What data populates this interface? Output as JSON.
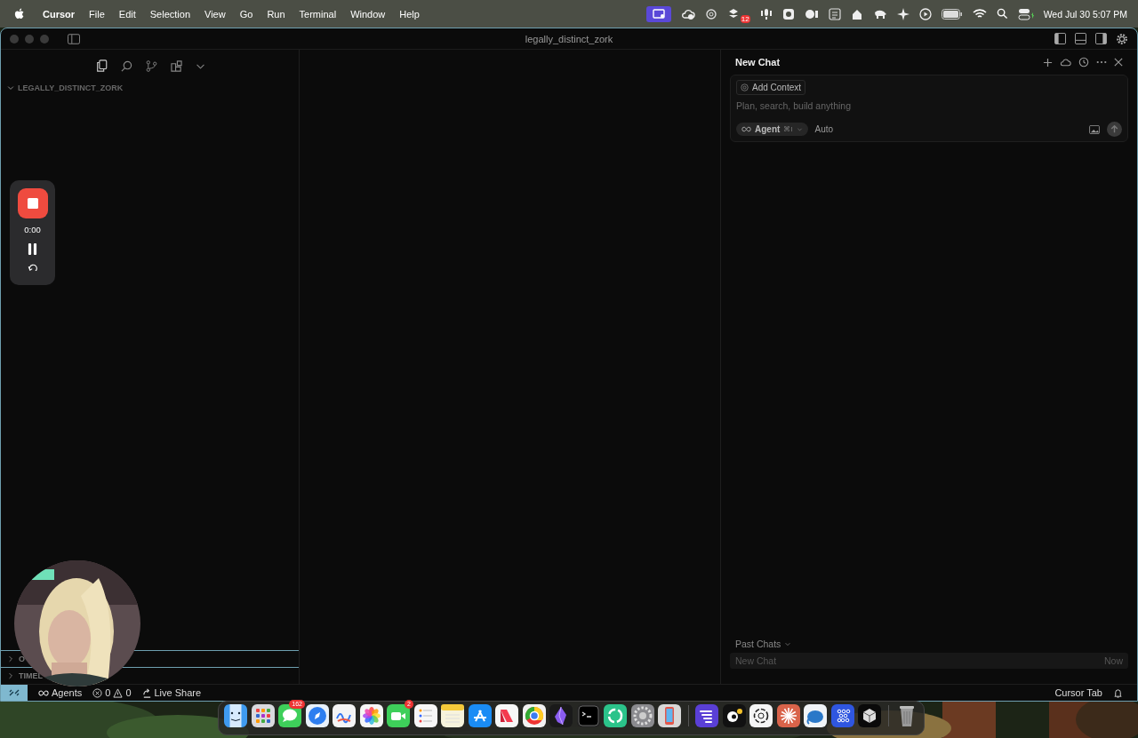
{
  "menubar": {
    "app_name": "Cursor",
    "menus": [
      "File",
      "Edit",
      "Selection",
      "View",
      "Go",
      "Run",
      "Terminal",
      "Window",
      "Help"
    ],
    "status_badge": "12",
    "clock": "Wed Jul 30  5:07 PM"
  },
  "window": {
    "title": "legally_distinct_zork"
  },
  "sidebar": {
    "folder": {
      "label": "LEGALLY_DISTINCT_ZORK",
      "expanded": true
    },
    "sections": [
      {
        "label": "O",
        "expanded": false
      },
      {
        "label": "TIMEL",
        "expanded": false
      }
    ]
  },
  "recorder": {
    "time": "0:00"
  },
  "chat": {
    "title": "New Chat",
    "context_button": "Add Context",
    "placeholder": "Plan, search, build anything",
    "mode": "Agent",
    "mode_shortcut": "⌘I",
    "model": "Auto",
    "past_chats_label": "Past Chats",
    "past_chats": [
      {
        "title": "New Chat",
        "time": "Now"
      }
    ]
  },
  "status_bar": {
    "agents": "Agents",
    "errors": "0",
    "warnings": "0",
    "live_share": "Live Share",
    "cursor_tab": "Cursor Tab"
  },
  "dock": [
    {
      "kind": "face"
    },
    {
      "kind": "grid"
    },
    {
      "kind": "bubble",
      "badge": "162"
    },
    {
      "kind": "compass"
    },
    {
      "kind": "scribble"
    },
    {
      "kind": "flower"
    },
    {
      "kind": "video",
      "badge": "2"
    },
    {
      "kind": "list"
    },
    {
      "kind": "notepad"
    },
    {
      "kind": "cross"
    },
    {
      "kind": "ribbon"
    },
    {
      "kind": "ring"
    },
    {
      "kind": "gem"
    },
    {
      "kind": "terminal"
    },
    {
      "kind": "arrows"
    },
    {
      "kind": "gear"
    },
    {
      "kind": "phone"
    },
    {
      "kind": "separator"
    },
    {
      "kind": "stripes"
    },
    {
      "kind": "dot"
    },
    {
      "kind": "knot"
    },
    {
      "kind": "burst"
    },
    {
      "kind": "blob"
    },
    {
      "kind": "dots"
    },
    {
      "kind": "cube"
    },
    {
      "kind": "separator"
    },
    {
      "kind": "trash"
    }
  ]
}
